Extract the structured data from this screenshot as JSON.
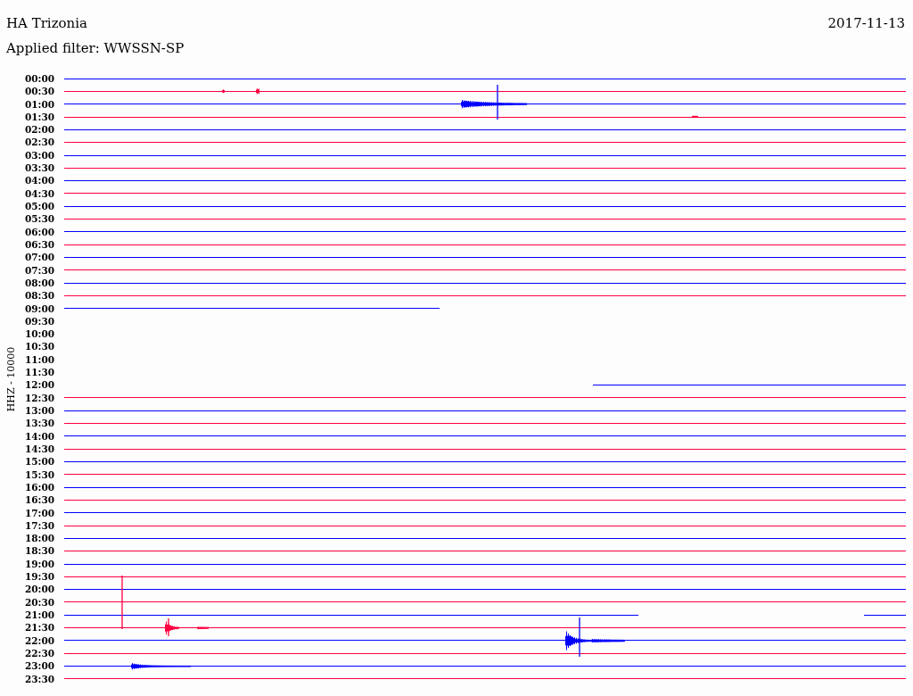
{
  "header": {
    "station": "HA Trizonia",
    "date": "2017-11-13",
    "filter": "Applied filter: WWSSN-SP"
  },
  "axis_label": "HHZ - 10000",
  "traces": [
    {
      "time": "00:00",
      "color": "#0000ff"
    },
    {
      "time": "00:30",
      "color": "#ff0040"
    },
    {
      "time": "01:00",
      "color": "#0000ff"
    },
    {
      "time": "01:30",
      "color": "#ff0040"
    },
    {
      "time": "02:00",
      "color": "#0000ff"
    },
    {
      "time": "02:30",
      "color": "#ff0040"
    },
    {
      "time": "03:00",
      "color": "#0000ff"
    },
    {
      "time": "03:30",
      "color": "#ff0040"
    },
    {
      "time": "04:00",
      "color": "#0000ff"
    },
    {
      "time": "04:30",
      "color": "#ff0040"
    },
    {
      "time": "05:00",
      "color": "#0000ff"
    },
    {
      "time": "05:30",
      "color": "#ff0040"
    },
    {
      "time": "06:00",
      "color": "#0000ff"
    },
    {
      "time": "06:30",
      "color": "#ff0040"
    },
    {
      "time": "07:00",
      "color": "#0000ff"
    },
    {
      "time": "07:30",
      "color": "#ff0040"
    },
    {
      "time": "08:00",
      "color": "#0000ff"
    },
    {
      "time": "08:30",
      "color": "#ff0040"
    },
    {
      "time": "09:00",
      "color": "#0000ff"
    },
    {
      "time": "09:30"
    },
    {
      "time": "10:00"
    },
    {
      "time": "10:30"
    },
    {
      "time": "11:00"
    },
    {
      "time": "11:30"
    },
    {
      "time": "12:00",
      "color": "#0000ff"
    },
    {
      "time": "12:30",
      "color": "#ff0040"
    },
    {
      "time": "13:00",
      "color": "#0000ff"
    },
    {
      "time": "13:30",
      "color": "#ff0040"
    },
    {
      "time": "14:00",
      "color": "#0000ff"
    },
    {
      "time": "14:30",
      "color": "#ff0040"
    },
    {
      "time": "15:00",
      "color": "#0000ff"
    },
    {
      "time": "15:30",
      "color": "#ff0040"
    },
    {
      "time": "16:00",
      "color": "#0000ff"
    },
    {
      "time": "16:30",
      "color": "#ff0040"
    },
    {
      "time": "17:00",
      "color": "#0000ff"
    },
    {
      "time": "17:30",
      "color": "#ff0040"
    },
    {
      "time": "18:00",
      "color": "#0000ff"
    },
    {
      "time": "18:30",
      "color": "#ff0040"
    },
    {
      "time": "19:00",
      "color": "#0000ff"
    },
    {
      "time": "19:30",
      "color": "#ff0040"
    },
    {
      "time": "20:00",
      "color": "#0000ff"
    },
    {
      "time": "20:30",
      "color": "#ff0040"
    },
    {
      "time": "21:00",
      "color": "#0000ff"
    },
    {
      "time": "21:30",
      "color": "#ff0040"
    },
    {
      "time": "22:00",
      "color": "#0000ff"
    },
    {
      "time": "22:30",
      "color": "#ff0040"
    },
    {
      "time": "23:00",
      "color": "#0000ff"
    },
    {
      "time": "23:30",
      "color": "#ff0040"
    }
  ]
}
